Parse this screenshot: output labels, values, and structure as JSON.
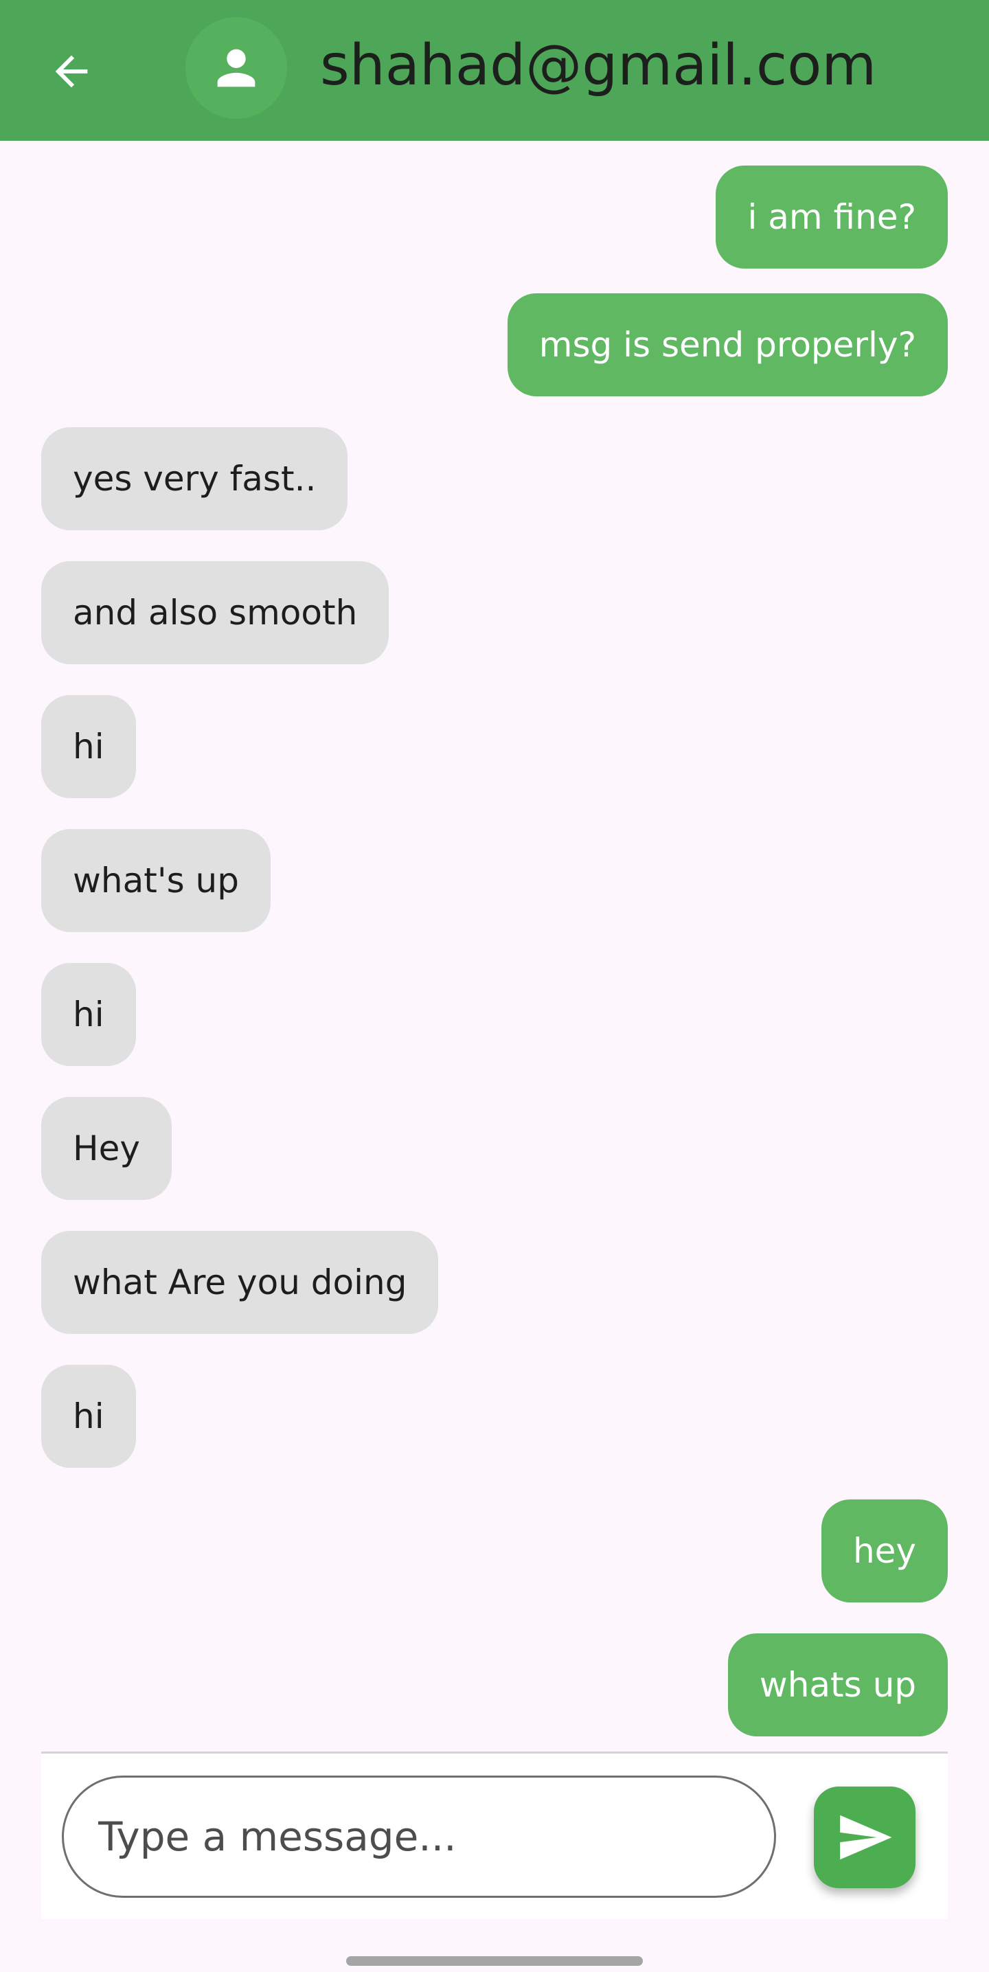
{
  "header": {
    "title": "shahad@gmail.com",
    "back_icon": "arrow-left-icon",
    "avatar_icon": "person-icon",
    "background": "#4ea758"
  },
  "messages": [
    {
      "text": "i am fine?",
      "direction": "sent"
    },
    {
      "text": "msg is send properly?",
      "direction": "sent"
    },
    {
      "text": "yes very fast..",
      "direction": "received"
    },
    {
      "text": "and also smooth",
      "direction": "received"
    },
    {
      "text": "hi",
      "direction": "received"
    },
    {
      "text": "what's up",
      "direction": "received"
    },
    {
      "text": "hi",
      "direction": "received"
    },
    {
      "text": "Hey",
      "direction": "received"
    },
    {
      "text": "what Are you doing",
      "direction": "received"
    },
    {
      "text": "hi",
      "direction": "received"
    },
    {
      "text": "hey",
      "direction": "sent"
    },
    {
      "text": "whats up",
      "direction": "sent"
    }
  ],
  "composer": {
    "placeholder": "Type a message...",
    "value": "",
    "send_icon": "send-icon"
  },
  "colors": {
    "sent_bubble": "#61b863",
    "received_bubble": "#e0e0e0",
    "send_button": "#4cae50"
  }
}
